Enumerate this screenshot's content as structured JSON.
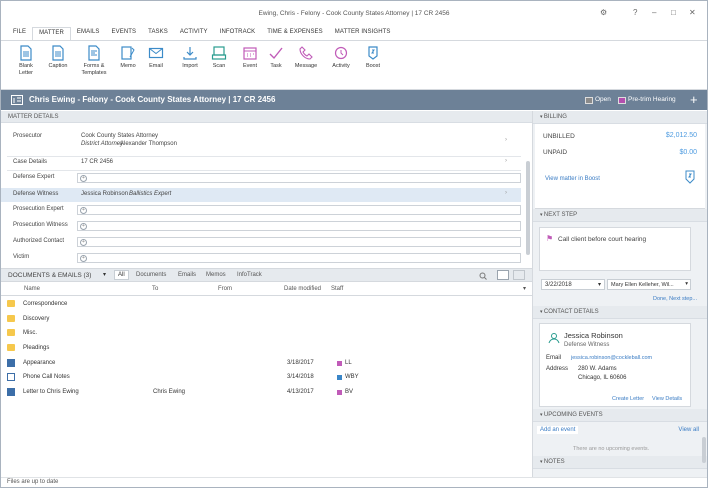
{
  "window": {
    "title": "Ewing, Chris - Felony - Cook County States Attorney | 17 CR 2456",
    "controls": [
      "⚙",
      "?",
      "–",
      "□",
      "✕"
    ]
  },
  "menu": {
    "tabs": [
      "FILE",
      "MATTER",
      "EMAILS",
      "EVENTS",
      "TASKS",
      "ACTIVITY",
      "INFOTRACK",
      "TIME & EXPENSES",
      "MATTER INSIGHTS"
    ],
    "active": "MATTER"
  },
  "ribbon": [
    {
      "label": "Blank\nLetter",
      "icon": "document-icon"
    },
    {
      "label": "Caption",
      "icon": "document-icon"
    },
    {
      "label": "Forms &\nTemplates",
      "icon": "forms-icon"
    },
    {
      "label": "Memo",
      "icon": "memo-icon"
    },
    {
      "label": "Email",
      "icon": "envelope-icon"
    },
    {
      "label": "Import",
      "icon": "download-icon"
    },
    {
      "label": "Scan",
      "icon": "scanner-icon"
    },
    {
      "label": "Event",
      "icon": "calendar-icon"
    },
    {
      "label": "Task",
      "icon": "check-icon"
    },
    {
      "label": "Message",
      "icon": "phone-icon"
    },
    {
      "label": "Activity",
      "icon": "activity-icon"
    },
    {
      "label": "Boost",
      "icon": "boost-icon"
    }
  ],
  "header": {
    "matter_title": "Chris Ewing - Felony - Cook County States Attorney | 17 CR 2456",
    "status_open": "Open",
    "status_hearing": "Pre-trim Hearing",
    "open_color": "#8a8a8a",
    "hearing_color": "#b34fae",
    "add": "+"
  },
  "matter_details": {
    "heading": "MATTER DETAILS",
    "prosecutor_label": "Prosecutor",
    "prosecutor_name": "Cook County States Attorney",
    "prosecutor_role": "District Attorney",
    "prosecutor_person": " Alexander Thompson",
    "case_label": "Case Details",
    "case_value": "17 CR 2456",
    "fields": [
      "Defense Expert",
      "Defense Witness",
      "Prosecution Expert",
      "Prosecution Witness",
      "Authorized Contact",
      "Victim"
    ],
    "witness_name": "Jessica Robinson",
    "witness_role": " Ballistics Expert"
  },
  "docs": {
    "heading": "DOCUMENTS & EMAILS (3)",
    "filters": [
      "All",
      "Documents",
      "Emails",
      "Memos",
      "InfoTrack"
    ],
    "columns": [
      "Name",
      "To",
      "From",
      "Date modified",
      "Staff"
    ],
    "folders": [
      "Correspondence",
      "Discovery",
      "Misc.",
      "Pleadings"
    ],
    "files": [
      {
        "name": "Appearance",
        "to": "",
        "date": "3/18/2017",
        "staff": "LL",
        "color": "#c05bb8"
      },
      {
        "name": "Phone Call Notes",
        "to": "",
        "date": "3/14/2018",
        "staff": "WBY",
        "color": "#3a86c8"
      },
      {
        "name": "Letter to Chris Ewing",
        "to": "Chris Ewing",
        "date": "4/13/2017",
        "staff": "BV",
        "color": "#c05bb8"
      }
    ],
    "status": "Files are up to date"
  },
  "billing": {
    "heading": "BILLING",
    "unbilled_label": "UNBILLED",
    "unbilled": "$2,012.50",
    "unpaid_label": "UNPAID",
    "unpaid": "$0.00",
    "link": "View matter in Boost"
  },
  "next_step": {
    "heading": "NEXT STEP",
    "text": "Call client before court hearing",
    "date": "3/22/2018",
    "assignee": "Mary Ellen Kelleher, Wil...",
    "done": "Done, Next step..."
  },
  "contact": {
    "heading": "CONTACT DETAILS",
    "name": "Jessica Robinson",
    "role": "Defense Witness",
    "email_label": "Email",
    "email": "jessica.robinson@cockleball.com",
    "address_label": "Address",
    "address1": "280 W. Adams",
    "address2": "Chicago, IL 60606",
    "create": "Create Letter",
    "view": "View Details"
  },
  "events": {
    "heading": "UPCOMING EVENTS",
    "add": "Add an event",
    "view": "View all",
    "none": "There are no upcoming events."
  },
  "notes": {
    "heading": "NOTES"
  }
}
